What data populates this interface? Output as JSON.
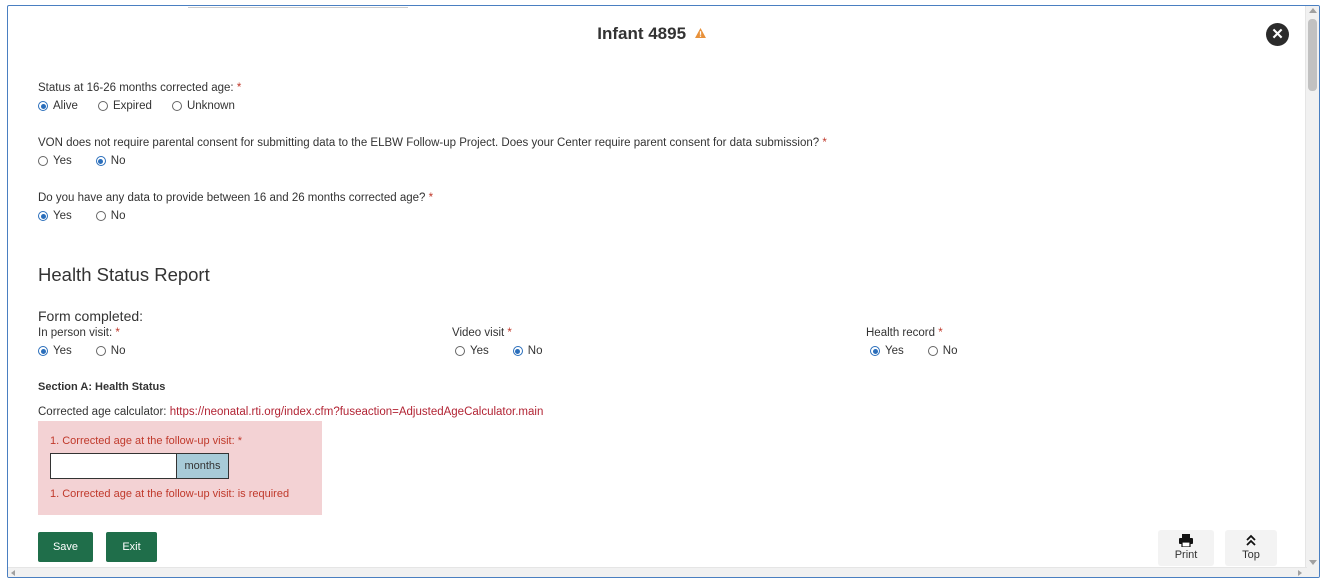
{
  "dialog": {
    "title": "Infant 4895",
    "close_glyph": "✕"
  },
  "questions": [
    {
      "label": "Status at 16-26 months corrected age:",
      "required": "*",
      "options": [
        {
          "label": "Alive",
          "checked": true
        },
        {
          "label": "Expired",
          "checked": false
        },
        {
          "label": "Unknown",
          "checked": false
        }
      ]
    },
    {
      "label": "VON does not require parental consent for submitting data to the ELBW Follow-up Project. Does your Center require parent consent for data submission?",
      "required": "*",
      "options": [
        {
          "label": "Yes",
          "checked": false
        },
        {
          "label": "No",
          "checked": true
        }
      ]
    },
    {
      "label": "Do you have any data to provide between 16 and 26 months corrected age?",
      "required": "*",
      "options": [
        {
          "label": "Yes",
          "checked": true
        },
        {
          "label": "No",
          "checked": false
        }
      ]
    }
  ],
  "health_status": {
    "heading": "Health Status Report",
    "form_completed": "Form completed:",
    "visit_types": [
      {
        "label": "In person visit:",
        "required": "*",
        "options": [
          {
            "label": "Yes",
            "checked": true
          },
          {
            "label": "No",
            "checked": false
          }
        ]
      },
      {
        "label": "Video visit",
        "required": "*",
        "options": [
          {
            "label": "Yes",
            "checked": false
          },
          {
            "label": "No",
            "checked": true
          }
        ]
      },
      {
        "label": "Health record",
        "required": "*",
        "options": [
          {
            "label": "Yes",
            "checked": true
          },
          {
            "label": "No",
            "checked": false
          }
        ]
      }
    ],
    "section_a": "Section A: Health Status",
    "calc_label": "Corrected age calculator:",
    "calc_link": "https://neonatal.rti.org/index.cfm?fuseaction=AdjustedAgeCalculator.main",
    "q1_label": "1. Corrected age at the follow-up visit:",
    "q1_required": "*",
    "q1_value": "",
    "q1_unit": "months",
    "q1_error": "1. Corrected age at the follow-up visit: is required"
  },
  "actions": {
    "save": "Save",
    "exit": "Exit",
    "print": "Print",
    "top": "Top"
  },
  "colors": {
    "primary_button": "#1f6e4a",
    "error_bg": "#f3d2d4",
    "error_text": "#c0392b",
    "link": "#b22434",
    "radio_selected": "#2a6ebb",
    "warning": "#e8913a"
  }
}
